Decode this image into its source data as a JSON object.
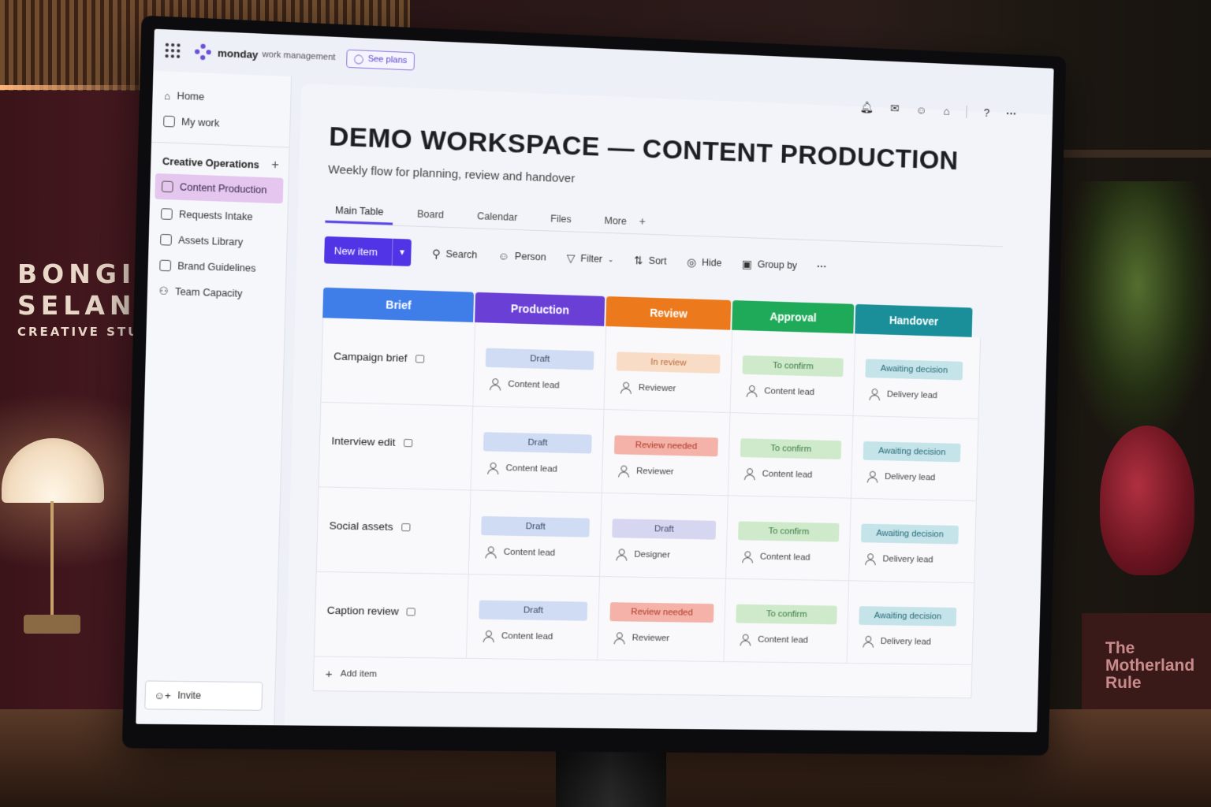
{
  "environment": {
    "sign": {
      "line1": "BONGIWE",
      "line2": "SELANE",
      "line3": "CREATIVE STUDIO"
    },
    "book": {
      "title": "The\nMotherland\nRule"
    }
  },
  "app": {
    "brand": "monday",
    "brand_sub": "work management",
    "see_plans": "See plans"
  },
  "top_icons": [
    "bell-icon",
    "inbox-icon",
    "invite-members-icon",
    "apps-marketplace-icon",
    "help-icon",
    "more-icon"
  ],
  "top_icon_glyphs": {
    "help": "?",
    "more": "···"
  },
  "sidebar": {
    "home": "Home",
    "my_work": "My work",
    "workspace": "Creative Operations",
    "add": "+",
    "boards": [
      {
        "label": "Content Production",
        "active": true
      },
      {
        "label": "Requests Intake",
        "active": false
      },
      {
        "label": "Assets Library",
        "active": false
      },
      {
        "label": "Brand Guidelines",
        "active": false
      },
      {
        "label": "Team Capacity",
        "active": false
      }
    ],
    "invite": "Invite"
  },
  "page": {
    "title": "DEMO WORKSPACE — CONTENT PRODUCTION",
    "subtitle": "Weekly flow for planning, review and handover"
  },
  "tabs": [
    "Main Table",
    "Board",
    "Calendar",
    "Files",
    "More"
  ],
  "tab_add": "+",
  "toolbar": {
    "new_item": "New item",
    "search": "Search",
    "person": "Person",
    "filter": "Filter",
    "sort": "Sort",
    "hide": "Hide",
    "group_by": "Group by",
    "more": "···"
  },
  "columns": [
    {
      "label": "Brief",
      "color": "#3f7ee8"
    },
    {
      "label": "Production",
      "color": "#6a3fd6"
    },
    {
      "label": "Review",
      "color": "#ec7a1c"
    },
    {
      "label": "Approval",
      "color": "#1faa5a"
    },
    {
      "label": "Handover",
      "color": "#1a8f9a"
    }
  ],
  "status_colors": {
    "Draft-blue": {
      "bg": "#cfdcf4",
      "fg": "#3a4a66"
    },
    "In review": {
      "bg": "#f9dcc6",
      "fg": "#b86a3a"
    },
    "Review needed": {
      "bg": "#f4b2a8",
      "fg": "#b03a2a"
    },
    "Draft-purple": {
      "bg": "#d6d6f0",
      "fg": "#4a4a70"
    },
    "To confirm": {
      "bg": "#cfeacb",
      "fg": "#3a7a40"
    },
    "Awaiting decision": {
      "bg": "#c4e4ea",
      "fg": "#2a6a78"
    }
  },
  "rows": [
    {
      "name": "Campaign brief",
      "production": {
        "status": "Draft",
        "style": "Draft-blue",
        "owner": "Content lead"
      },
      "review": {
        "status": "In review",
        "style": "In review",
        "owner": "Reviewer"
      },
      "approval": {
        "status": "To confirm",
        "style": "To confirm",
        "owner": "Content lead"
      },
      "handover": {
        "status": "Awaiting decision",
        "style": "Awaiting decision",
        "owner": "Delivery lead"
      }
    },
    {
      "name": "Interview edit",
      "production": {
        "status": "Draft",
        "style": "Draft-blue",
        "owner": "Content lead"
      },
      "review": {
        "status": "Review needed",
        "style": "Review needed",
        "owner": "Reviewer"
      },
      "approval": {
        "status": "To confirm",
        "style": "To confirm",
        "owner": "Content lead"
      },
      "handover": {
        "status": "Awaiting decision",
        "style": "Awaiting decision",
        "owner": "Delivery lead"
      }
    },
    {
      "name": "Social assets",
      "production": {
        "status": "Draft",
        "style": "Draft-blue",
        "owner": "Content lead"
      },
      "review": {
        "status": "Draft",
        "style": "Draft-purple",
        "owner": "Designer"
      },
      "approval": {
        "status": "To confirm",
        "style": "To confirm",
        "owner": "Content lead"
      },
      "handover": {
        "status": "Awaiting decision",
        "style": "Awaiting decision",
        "owner": "Delivery lead"
      }
    },
    {
      "name": "Caption review",
      "production": {
        "status": "Draft",
        "style": "Draft-blue",
        "owner": "Content lead"
      },
      "review": {
        "status": "Review needed",
        "style": "Review needed",
        "owner": "Reviewer"
      },
      "approval": {
        "status": "To confirm",
        "style": "To confirm",
        "owner": "Content lead"
      },
      "handover": {
        "status": "Awaiting decision",
        "style": "Awaiting decision",
        "owner": "Delivery lead"
      }
    }
  ],
  "add_item": "Add item"
}
